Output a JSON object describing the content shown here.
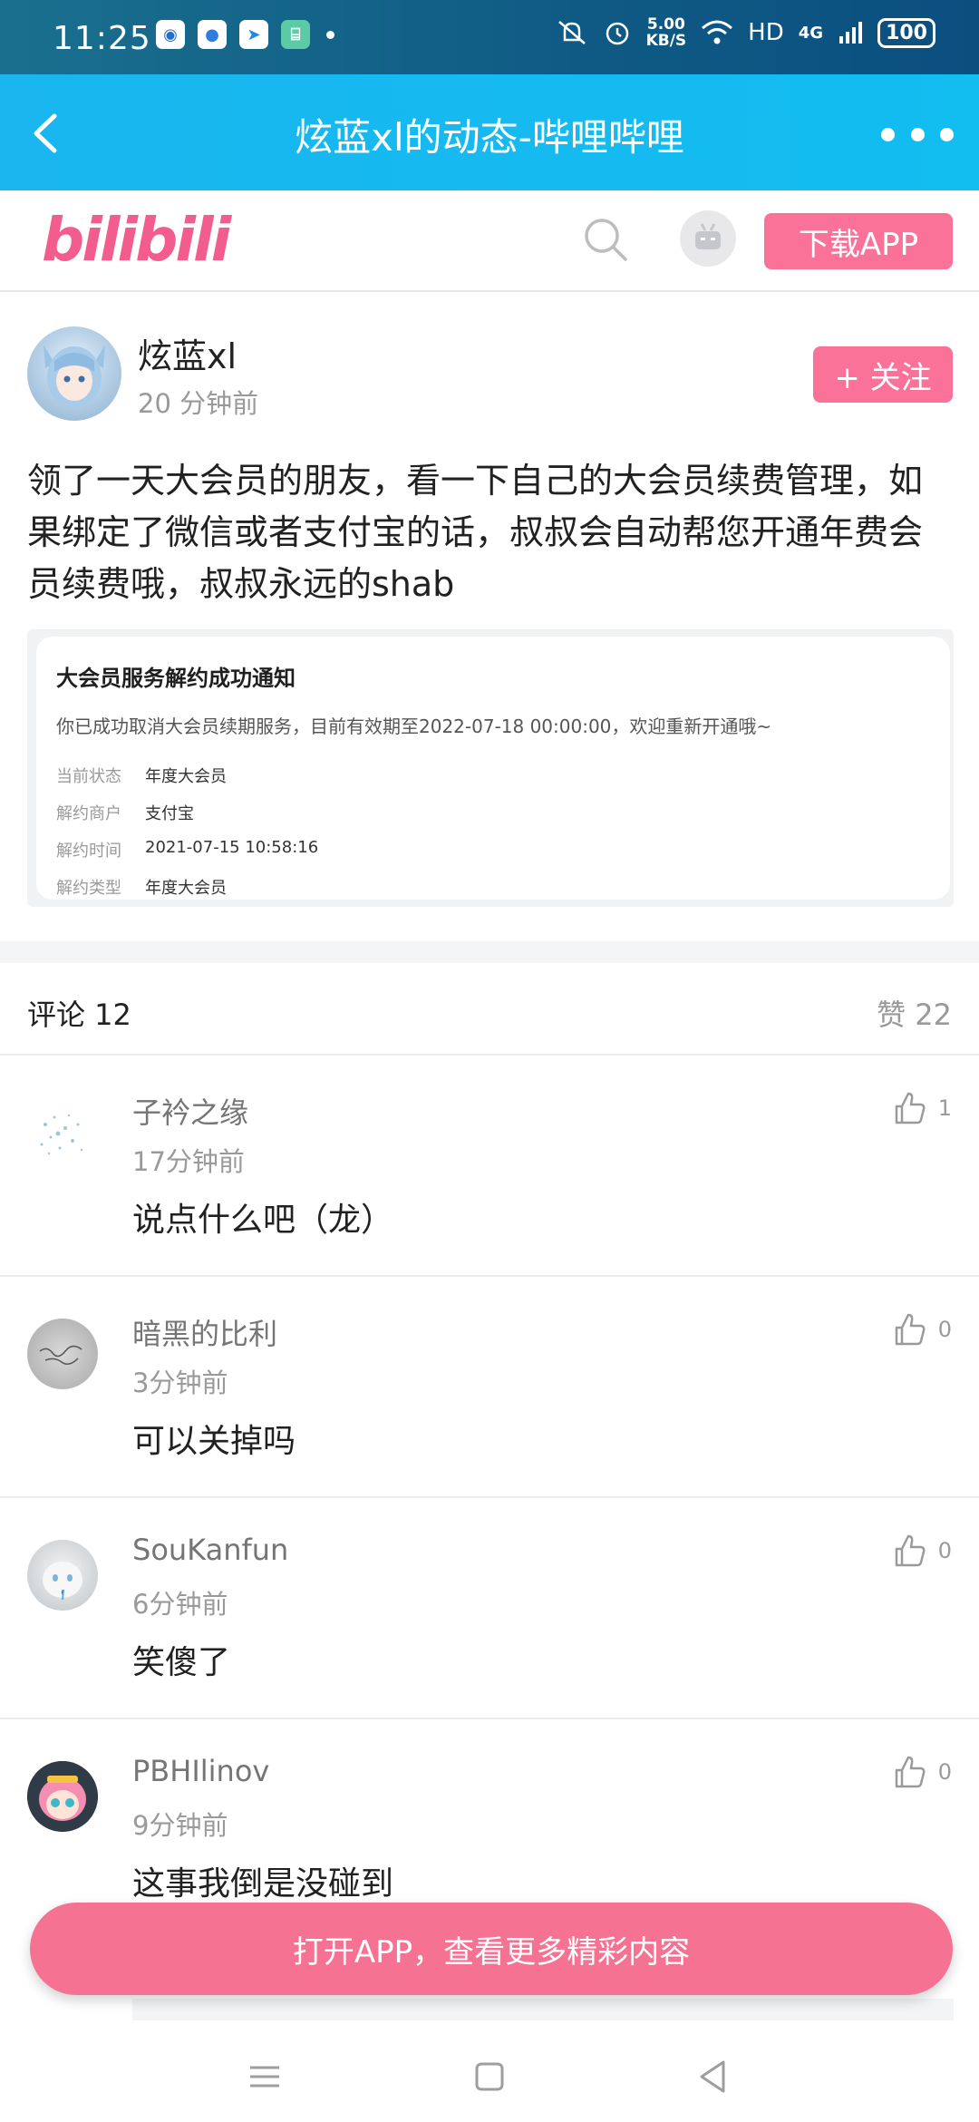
{
  "status_bar": {
    "time": "11:25",
    "speed_value": "5.00",
    "speed_unit": "KB/S",
    "network": "HD",
    "signal": "4G",
    "battery": "100"
  },
  "app_bar": {
    "title": "炫蓝xl的动态-哔哩哔哩"
  },
  "site_header": {
    "logo": "bilibili",
    "download_label": "下载APP"
  },
  "post": {
    "author": "炫蓝xl",
    "time": "20 分钟前",
    "follow_label": "+ 关注",
    "text": "领了一天大会员的朋友，看一下自己的大会员续费管理，如果绑定了微信或者支付宝的话，叔叔会自动帮您开通年费会员续费哦，叔叔永远的shab",
    "notice": {
      "title": "大会员服务解约成功通知",
      "desc": "你已成功取消大会员续期服务，目前有效期至2022-07-18 00:00:00，欢迎重新开通哦~",
      "rows": [
        {
          "key": "当前状态",
          "value": "年度大会员"
        },
        {
          "key": "解约商户",
          "value": "支付宝"
        },
        {
          "key": "解约时间",
          "value": "2021-07-15 10:58:16"
        },
        {
          "key": "解约类型",
          "value": "年度大会员"
        }
      ]
    }
  },
  "comments_header": {
    "count_label": "评论 12",
    "likes_label": "赞 22"
  },
  "comments": [
    {
      "name": "子衿之缘",
      "time": "17分钟前",
      "text": "说点什么吧（龙）",
      "likes": "1"
    },
    {
      "name": "暗黑的比利",
      "time": "3分钟前",
      "text": "可以关掉吗",
      "likes": "0"
    },
    {
      "name": "SouKanfun",
      "time": "6分钟前",
      "text": "笑傻了",
      "likes": "0"
    },
    {
      "name": "PBHIlinov",
      "time": "9分钟前",
      "text": "这事我倒是没碰到",
      "likes": "0"
    }
  ],
  "cta": {
    "open_app_label": "打开APP，查看更多精彩内容"
  },
  "colors": {
    "bili_pink": "#fb7299",
    "app_bar_blue": "#19b6ef"
  }
}
